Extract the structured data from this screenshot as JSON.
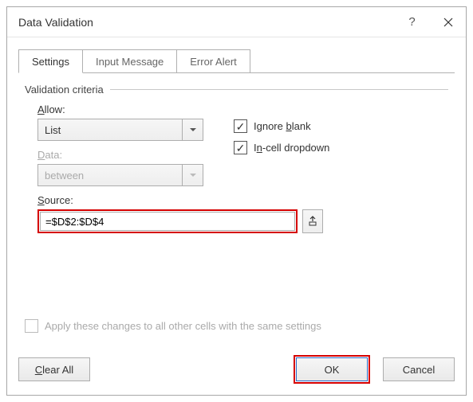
{
  "window": {
    "title": "Data Validation"
  },
  "tabs": {
    "settings": "Settings",
    "input_message": "Input Message",
    "error_alert": "Error Alert"
  },
  "criteria": {
    "legend": "Validation criteria",
    "allow_label": "Allow:",
    "allow_value": "List",
    "data_label": "Data:",
    "data_value": "between",
    "source_label": "Source:",
    "source_value": "=$D$2:$D$4"
  },
  "checks": {
    "ignore_blank_pre": "Ignore ",
    "ignore_blank_u": "b",
    "ignore_blank_post": "lank",
    "ignore_blank_checked": "✓",
    "incell_pre": "I",
    "incell_u": "n",
    "incell_post": "-cell dropdown",
    "incell_checked": "✓"
  },
  "apply": {
    "label_pre": "Apply these changes to all other cells with the same settings"
  },
  "footer": {
    "clear_u": "C",
    "clear_post": "lear All",
    "ok": "OK",
    "cancel": "Cancel"
  }
}
